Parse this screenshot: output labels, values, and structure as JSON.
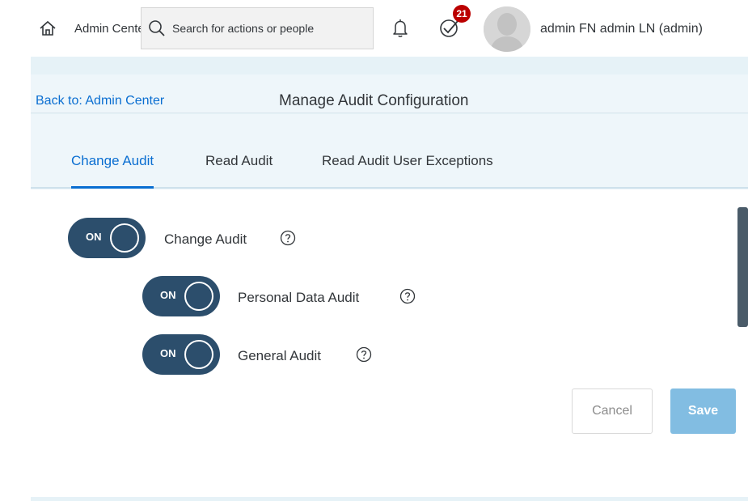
{
  "shell": {
    "app_title": "Admin Center",
    "search_placeholder": "Search for actions or people",
    "todo_count": "21",
    "user_name": "admin FN admin LN (admin)"
  },
  "header": {
    "back_link": "Back to: Admin Center",
    "title": "Manage Audit Configuration"
  },
  "tabs": [
    {
      "label": "Change Audit",
      "active": true
    },
    {
      "label": "Read Audit",
      "active": false
    },
    {
      "label": "Read Audit User Exceptions",
      "active": false
    }
  ],
  "settings": [
    {
      "label": "Change Audit",
      "state": "ON"
    },
    {
      "label": "Personal Data Audit",
      "state": "ON"
    },
    {
      "label": "General Audit",
      "state": "ON"
    }
  ],
  "actions": {
    "cancel_label": "Cancel",
    "save_label": "Save"
  },
  "colors": {
    "toggle_on": "#2c4e6c",
    "link": "#0a6ed1",
    "save_disabled": "#82bde2",
    "badge": "#bb0000",
    "page_bg": "#e6f2f7"
  },
  "icons": [
    "home-icon",
    "search-icon",
    "bell-icon",
    "todo-check-icon",
    "avatar-silhouette",
    "help-icon"
  ]
}
